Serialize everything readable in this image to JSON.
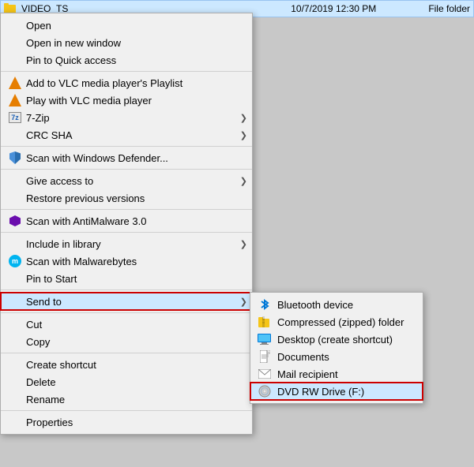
{
  "fileRow": {
    "name": "VIDEO_TS",
    "date": "10/7/2019 12:30 PM",
    "type": "File folder"
  },
  "contextMenu": {
    "items": [
      {
        "id": "open",
        "label": "Open",
        "icon": null,
        "hasArrow": false,
        "separator_after": false
      },
      {
        "id": "open-new-window",
        "label": "Open in new window",
        "icon": null,
        "hasArrow": false,
        "separator_after": false
      },
      {
        "id": "pin-quick-access",
        "label": "Pin to Quick access",
        "icon": null,
        "hasArrow": false,
        "separator_after": false
      },
      {
        "id": "add-vlc-playlist",
        "label": "Add to VLC media player's Playlist",
        "icon": "vlc",
        "hasArrow": false,
        "separator_after": false
      },
      {
        "id": "play-vlc",
        "label": "Play with VLC media player",
        "icon": "vlc",
        "hasArrow": false,
        "separator_after": false
      },
      {
        "id": "7zip",
        "label": "7-Zip",
        "icon": "7zip",
        "hasArrow": true,
        "separator_after": false
      },
      {
        "id": "crc-sha",
        "label": "CRC SHA",
        "icon": null,
        "hasArrow": true,
        "separator_after": true
      },
      {
        "id": "scan-defender",
        "label": "Scan with Windows Defender...",
        "icon": "shield",
        "hasArrow": false,
        "separator_after": true
      },
      {
        "id": "give-access",
        "label": "Give access to",
        "icon": null,
        "hasArrow": true,
        "separator_after": false
      },
      {
        "id": "restore-versions",
        "label": "Restore previous versions",
        "icon": null,
        "hasArrow": false,
        "separator_after": true
      },
      {
        "id": "scan-antimalware",
        "label": "Scan with AntiMalware 3.0",
        "icon": "antimalware",
        "hasArrow": false,
        "separator_after": true
      },
      {
        "id": "include-library",
        "label": "Include in library",
        "icon": null,
        "hasArrow": true,
        "separator_after": false
      },
      {
        "id": "scan-malwarebytes",
        "label": "Scan with Malwarebytes",
        "icon": "malware",
        "hasArrow": false,
        "separator_after": false
      },
      {
        "id": "pin-start",
        "label": "Pin to Start",
        "icon": null,
        "hasArrow": false,
        "separator_after": true
      },
      {
        "id": "send-to",
        "label": "Send to",
        "icon": null,
        "hasArrow": true,
        "separator_after": true,
        "highlighted": true
      },
      {
        "id": "cut",
        "label": "Cut",
        "icon": null,
        "hasArrow": false,
        "separator_after": false
      },
      {
        "id": "copy",
        "label": "Copy",
        "icon": null,
        "hasArrow": false,
        "separator_after": true
      },
      {
        "id": "create-shortcut",
        "label": "Create shortcut",
        "icon": null,
        "hasArrow": false,
        "separator_after": false
      },
      {
        "id": "delete",
        "label": "Delete",
        "icon": null,
        "hasArrow": false,
        "separator_after": false
      },
      {
        "id": "rename",
        "label": "Rename",
        "icon": null,
        "hasArrow": false,
        "separator_after": true
      },
      {
        "id": "properties",
        "label": "Properties",
        "icon": null,
        "hasArrow": false,
        "separator_after": false
      }
    ]
  },
  "submenu": {
    "items": [
      {
        "id": "bluetooth",
        "label": "Bluetooth device",
        "icon": "bluetooth",
        "highlighted": false
      },
      {
        "id": "compressed",
        "label": "Compressed (zipped) folder",
        "icon": "zip",
        "highlighted": false
      },
      {
        "id": "desktop",
        "label": "Desktop (create shortcut)",
        "icon": "desktop",
        "highlighted": false
      },
      {
        "id": "documents",
        "label": "Documents",
        "icon": "documents",
        "highlighted": false
      },
      {
        "id": "mail",
        "label": "Mail recipient",
        "icon": "mail",
        "highlighted": false
      },
      {
        "id": "dvd",
        "label": "DVD RW Drive (F:)",
        "icon": "dvd",
        "highlighted": true
      }
    ]
  }
}
